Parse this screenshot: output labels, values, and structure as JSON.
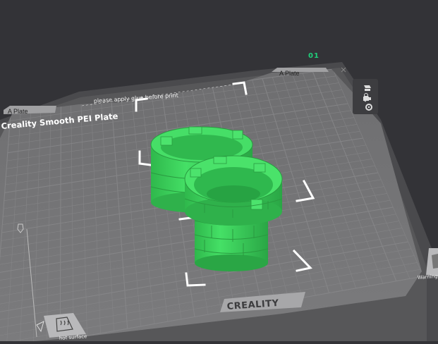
{
  "plate": {
    "number": "01",
    "tab_label": "A Plate",
    "tab_label_left": "A Plate",
    "name": "Creality Smooth PEI Plate",
    "notice": "please apply glue before print",
    "brand": "CREALITY",
    "hot_surface_label": "hot surface",
    "warning_label": "Warning"
  },
  "toolbar": {
    "icons": [
      "orient-icon",
      "arrange-icon",
      "lock-icon",
      "settings-icon"
    ]
  },
  "colors": {
    "background": "#333337",
    "bed_surface": "#767678",
    "grid": "#8a8a8c",
    "model": "#3bd55a",
    "model_shadow": "#2a9a40",
    "accent": "#1fd07a",
    "selection": "#ffffff"
  }
}
